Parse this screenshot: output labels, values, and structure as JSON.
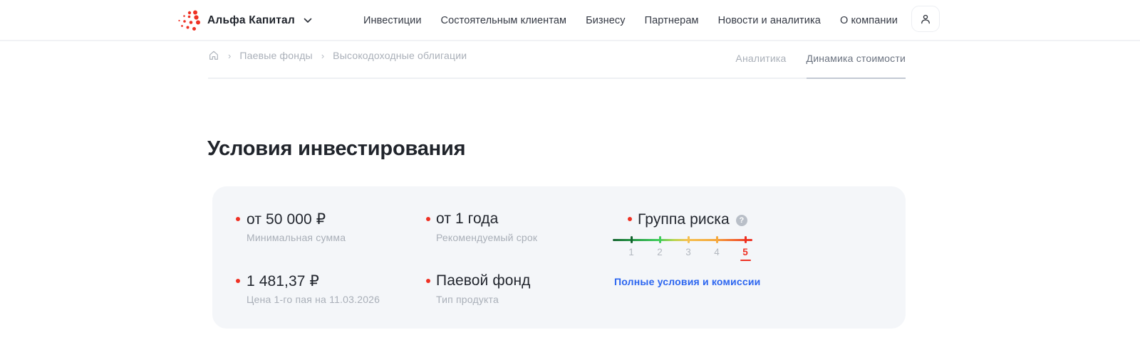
{
  "header": {
    "brand": "Альфа Капитал",
    "nav": [
      "Инвестиции",
      "Состоятельным клиентам",
      "Бизнесу",
      "Партнерам",
      "Новости и аналитика",
      "О компании"
    ]
  },
  "breadcrumb": {
    "items": [
      "Паевые фонды",
      "Высокодоходные облигации"
    ],
    "separator": "›"
  },
  "tabs": [
    {
      "label": "Аналитика",
      "active": false
    },
    {
      "label": "Динамика стоимости",
      "active": true
    }
  ],
  "page": {
    "title": "Условия инвестирования"
  },
  "conditions": {
    "items": [
      {
        "value": "от 50 000 ₽",
        "label": "Минимальная сумма"
      },
      {
        "value": "от 1 года",
        "label": "Рекомендуемый срок"
      },
      {
        "value": "1 481,37 ₽",
        "label": "Цена 1-го пая на 11.03.2026"
      },
      {
        "value": "Паевой фонд",
        "label": "Тип продукта"
      }
    ],
    "risk": {
      "title": "Группа риска",
      "help": "?",
      "levels": [
        "1",
        "2",
        "3",
        "4",
        "5"
      ],
      "selected": "5",
      "tick_colors": [
        "#14632f",
        "#3ecb5b",
        "#f5c050",
        "#f5a93c",
        "#ee2f23"
      ]
    },
    "link": "Полные условия и комиссии"
  },
  "colors": {
    "brand_red": "#EF3124",
    "link_blue": "#2B65F0",
    "card_background": "#F4F6F9",
    "muted_text": "#A9AFB8",
    "dark_text": "#22262E"
  }
}
